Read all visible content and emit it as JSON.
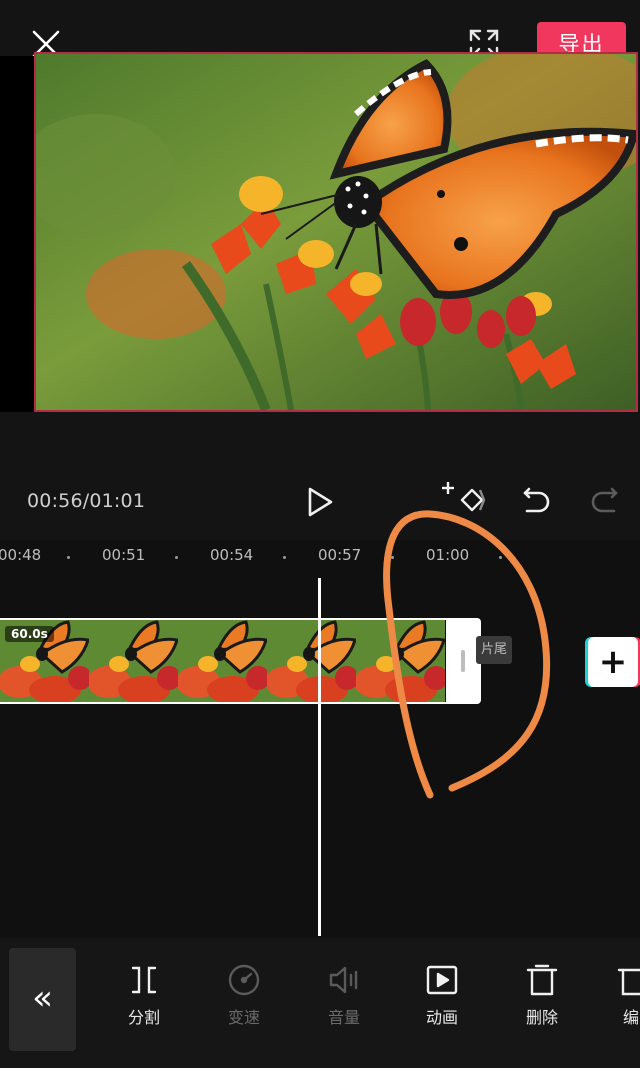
{
  "header": {
    "export_label": "导出"
  },
  "controls": {
    "timecode": "00:56/01:01"
  },
  "timeline": {
    "ruler": [
      {
        "label": "00:48"
      },
      {
        "label": "00:51"
      },
      {
        "label": "00:54"
      },
      {
        "label": "00:57"
      },
      {
        "label": "01:00"
      }
    ],
    "clip_duration": "60.0s",
    "ending_label": "片尾",
    "add_label": "+"
  },
  "toolbar": {
    "collapse_glyph": "«",
    "tools": [
      {
        "label": "分割",
        "icon": "split-icon",
        "enabled": true
      },
      {
        "label": "变速",
        "icon": "speed-icon",
        "enabled": false
      },
      {
        "label": "音量",
        "icon": "volume-icon",
        "enabled": false
      },
      {
        "label": "动画",
        "icon": "animation-icon",
        "enabled": true
      },
      {
        "label": "删除",
        "icon": "delete-icon",
        "enabled": true
      },
      {
        "label": "编",
        "icon": "edit-icon",
        "enabled": true
      }
    ]
  },
  "colors": {
    "accent": "#f1375d",
    "background": "#101010",
    "annotation": "#ee8a45"
  }
}
